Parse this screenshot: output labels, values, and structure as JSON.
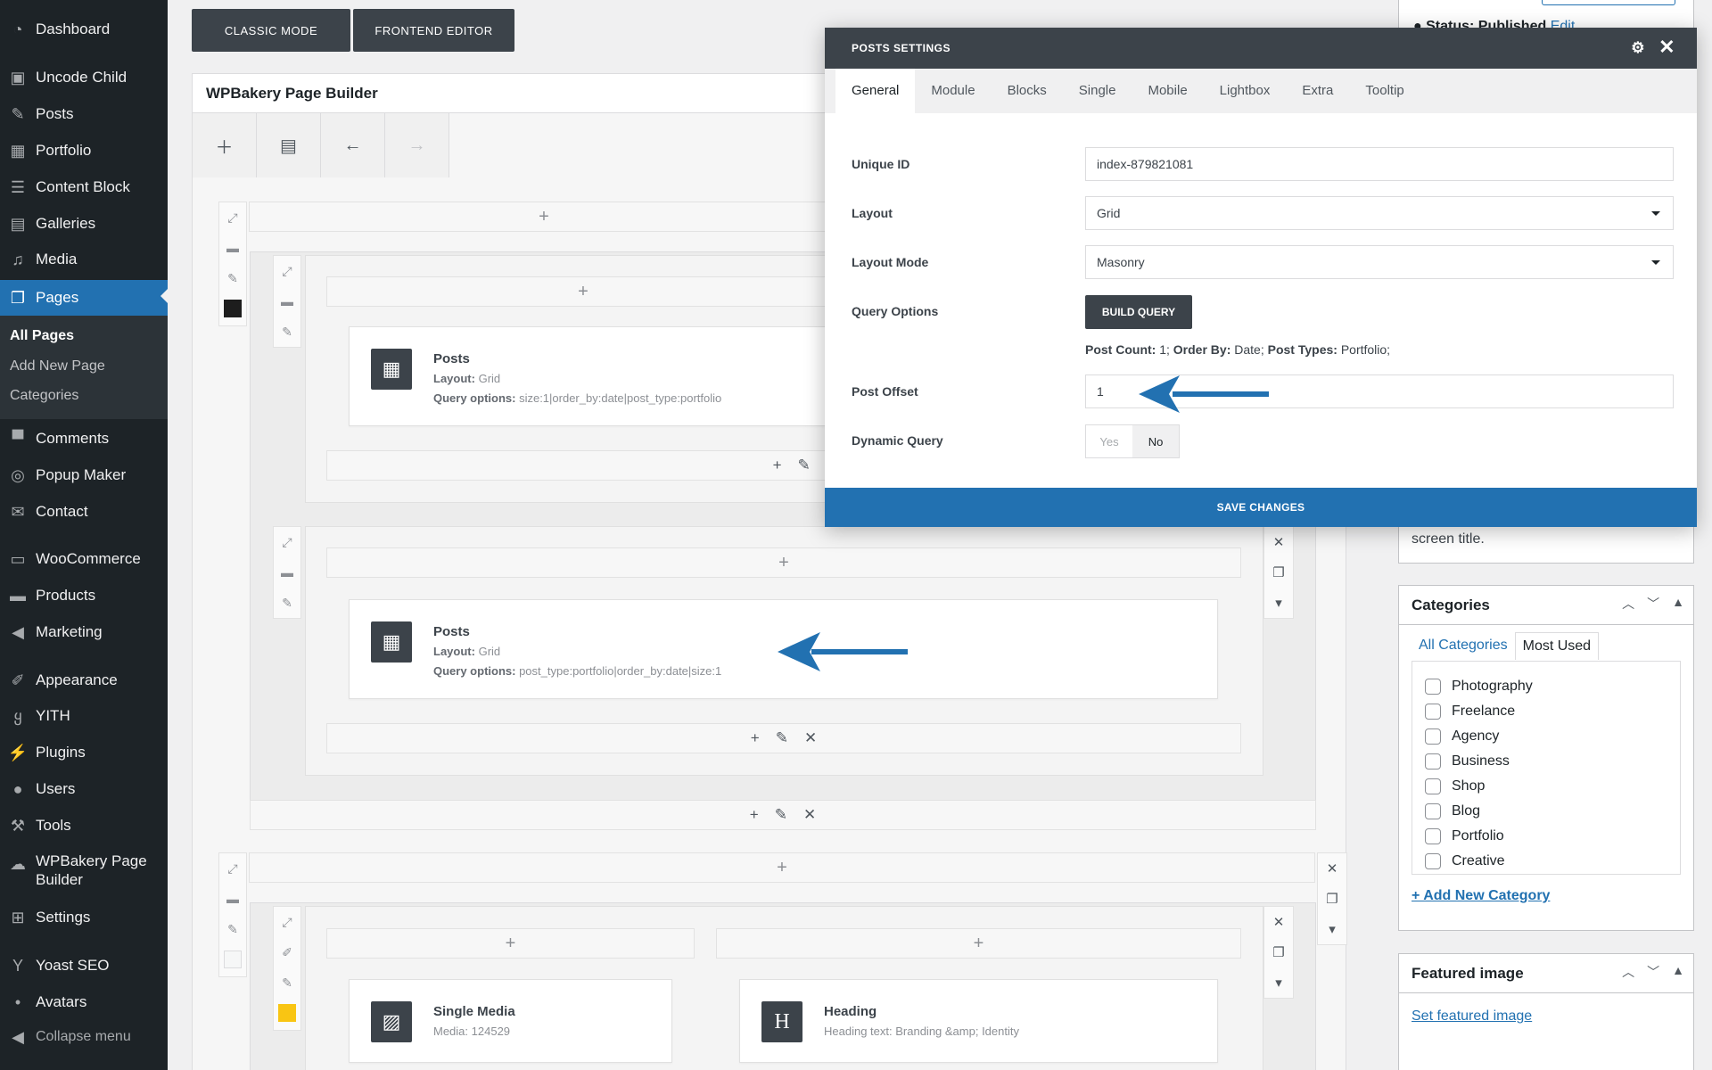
{
  "admin_menu": {
    "items": [
      {
        "label": "Dashboard",
        "icon": "dashboard-icon"
      },
      {
        "label": "Uncode Child",
        "icon": "theme-icon"
      },
      {
        "label": "Posts",
        "icon": "pin-icon"
      },
      {
        "label": "Portfolio",
        "icon": "grid-icon"
      },
      {
        "label": "Content Block",
        "icon": "list-icon"
      },
      {
        "label": "Galleries",
        "icon": "gallery-icon"
      },
      {
        "label": "Media",
        "icon": "media-icon"
      },
      {
        "label": "Pages",
        "icon": "pages-icon"
      },
      {
        "label": "Comments",
        "icon": "comment-icon"
      },
      {
        "label": "Popup Maker",
        "icon": "popup-icon"
      },
      {
        "label": "Contact",
        "icon": "mail-icon"
      },
      {
        "label": "WooCommerce",
        "icon": "woo-icon"
      },
      {
        "label": "Products",
        "icon": "products-icon"
      },
      {
        "label": "Marketing",
        "icon": "megaphone-icon"
      },
      {
        "label": "Appearance",
        "icon": "brush-icon"
      },
      {
        "label": "YITH",
        "icon": "yith-icon"
      },
      {
        "label": "Plugins",
        "icon": "plug-icon"
      },
      {
        "label": "Users",
        "icon": "user-icon"
      },
      {
        "label": "Tools",
        "icon": "wrench-icon"
      },
      {
        "label": "WPBakery Page Builder",
        "icon": "bakery-icon"
      },
      {
        "label": "Settings",
        "icon": "settings-icon"
      },
      {
        "label": "Yoast SEO",
        "icon": "yoast-icon"
      },
      {
        "label": "Avatars",
        "icon": "avatar-icon"
      }
    ],
    "submenu": [
      "All Pages",
      "Add New Page",
      "Categories"
    ],
    "collapse": "Collapse menu"
  },
  "editor": {
    "classic_mode": "CLASSIC MODE",
    "frontend_editor": "FRONTEND EDITOR",
    "builder_title": "WPBakery Page Builder",
    "plus": "+",
    "edit": "✎",
    "close": "✕",
    "elements": {
      "posts_a": {
        "name": "Posts",
        "layout_label": "Layout:",
        "layout_value": "Grid",
        "query_label": "Query options:",
        "query_value": "size:1|order_by:date|post_type:portfolio"
      },
      "posts_b": {
        "name": "Posts",
        "layout_label": "Layout:",
        "layout_value": "Grid",
        "query_label": "Query options:",
        "query_value": "post_type:portfolio|order_by:date|size:1"
      },
      "media": {
        "name": "Single Media",
        "media_label": "Media:",
        "media_value": "124529",
        "icon_letter": ""
      },
      "heading": {
        "name": "Heading",
        "text_label": "Heading text:",
        "text_value": "Branding &amp; Identity",
        "icon_letter": "H"
      }
    }
  },
  "sidebar": {
    "status_fragment": "Status: Published",
    "status_edit": "Edit",
    "screen_title_fragment": "screen title.",
    "categories": {
      "title": "Categories",
      "tab_all": "All Categories",
      "tab_most": "Most Used",
      "items": [
        "Photography",
        "Freelance",
        "Agency",
        "Business",
        "Shop",
        "Blog",
        "Portfolio",
        "Creative"
      ],
      "add_new": "+ Add New Category"
    },
    "featured": {
      "title": "Featured image",
      "set_link": "Set featured image"
    }
  },
  "modal": {
    "title": "POSTS SETTINGS",
    "tabs": [
      "General",
      "Module",
      "Blocks",
      "Single",
      "Mobile",
      "Lightbox",
      "Extra",
      "Tooltip"
    ],
    "fields": {
      "unique_id": {
        "label": "Unique ID",
        "value": "index-879821081"
      },
      "layout": {
        "label": "Layout",
        "value": "Grid"
      },
      "layout_mode": {
        "label": "Layout Mode",
        "value": "Masonry"
      },
      "query_options": {
        "label": "Query Options",
        "button": "BUILD QUERY"
      },
      "post_offset": {
        "label": "Post Offset",
        "value": "1"
      },
      "dynamic_query": {
        "label": "Dynamic Query",
        "yes": "Yes",
        "no": "No"
      }
    },
    "query_summary": {
      "count_label": "Post Count:",
      "count_value": "1;",
      "order_label": "Order By:",
      "order_value": "Date;",
      "types_label": "Post Types:",
      "types_value": "Portfolio;"
    },
    "save": "SAVE CHANGES"
  },
  "colors": {
    "accent": "#2271b1",
    "sidebar_bg": "#1d2327",
    "header_dark": "#3c434a",
    "swatch_black": "#1d1d1d",
    "swatch_yellow": "#f9c513"
  }
}
